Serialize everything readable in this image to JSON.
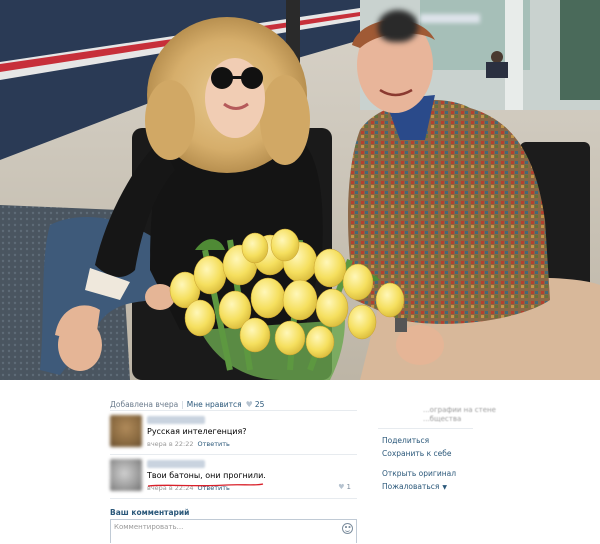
{
  "post": {
    "added": "Добавлена вчера",
    "like_label": "Мне нравится",
    "like_count": "25"
  },
  "comments": [
    {
      "text": "Русская интелегенция?",
      "time": "вчера в 22:22",
      "reply": "Ответить",
      "likes": ""
    },
    {
      "text": "Твои батоны, они прогнили.",
      "time": "вчера в 22:24",
      "reply": "Ответить",
      "likes": "1"
    }
  ],
  "compose": {
    "heading": "Ваш комментарий",
    "placeholder": "Комментировать..."
  },
  "sidebar": {
    "owner_sub_line1": "...ографии на стене",
    "owner_sub_line2": "...бщества",
    "actions": {
      "share": "Поделиться",
      "save": "Сохранить к себе",
      "open_original": "Открыть оригинал",
      "report": "Пожаловаться"
    }
  },
  "colors": {
    "link": "#2b587a",
    "meta": "#6b7b8c",
    "underline": "#d9202a"
  }
}
